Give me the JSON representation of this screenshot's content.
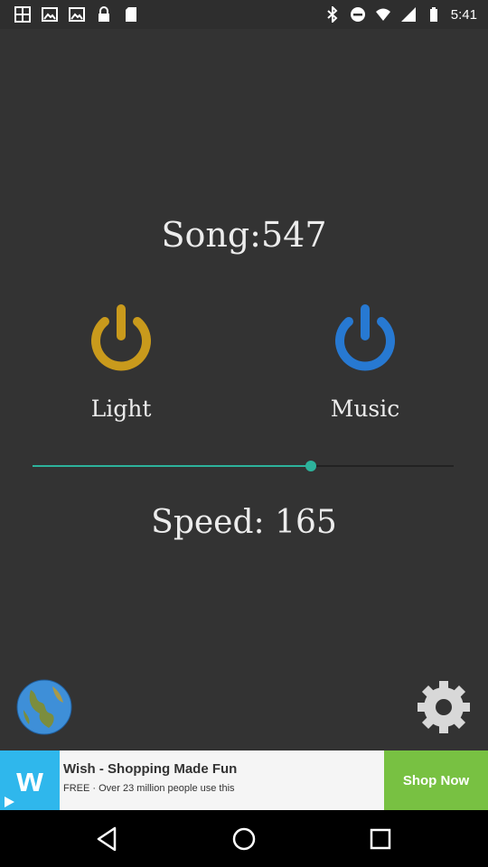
{
  "status_bar": {
    "time": "5:41",
    "left_icons": [
      "grid-icon",
      "image-icon",
      "image-icon",
      "lock-icon",
      "sd-card-icon"
    ],
    "right_icons": [
      "bluetooth-icon",
      "do-not-disturb-icon",
      "wifi-icon",
      "signal-icon",
      "battery-icon"
    ]
  },
  "main": {
    "song_title": "Song:547",
    "light_label": "Light",
    "music_label": "Music",
    "speed_text": "Speed: 165",
    "slider_fraction": 0.66,
    "colors": {
      "light_power": "#c99a1c",
      "music_power": "#2779d2",
      "slider_accent": "#2db39c",
      "background": "#333333"
    }
  },
  "ad": {
    "logo_letter": "w",
    "title": "Wish - Shopping Made Fun",
    "subtitle": "FREE · Over 23 million people use this",
    "cta": "Shop Now",
    "colors": {
      "logo_bg": "#2fb7ec",
      "cta_bg": "#78c142"
    }
  },
  "nav": {
    "icons": [
      "back-icon",
      "home-icon",
      "recent-apps-icon"
    ]
  }
}
